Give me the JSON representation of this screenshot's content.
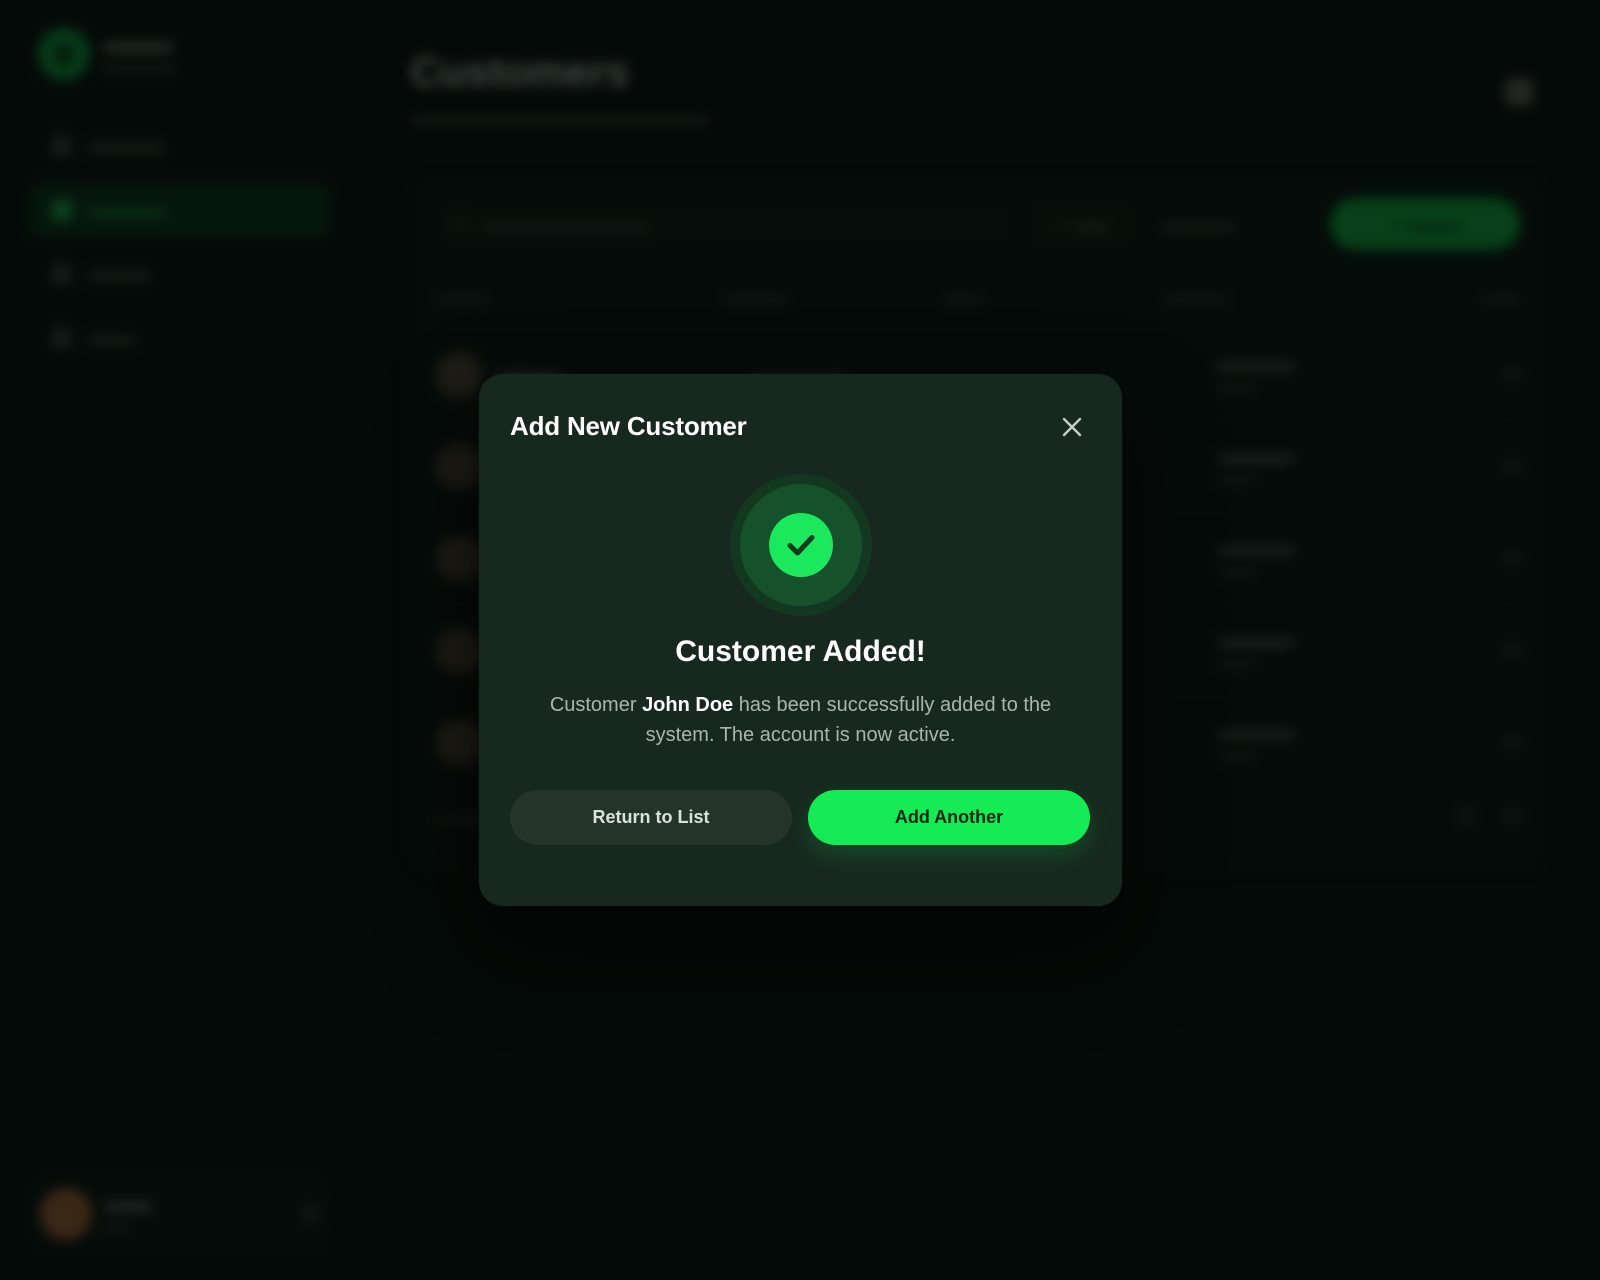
{
  "colors": {
    "accent": "#15eb55",
    "modal_bg": "#17281e",
    "page_bg": "#070d0a",
    "secondary_button_bg": "#243429"
  },
  "background": {
    "page_title": "Customers"
  },
  "modal": {
    "title": "Add New Customer",
    "close_icon": "close-icon",
    "success_icon": "check-circle-icon",
    "heading": "Customer Added!",
    "message": {
      "prefix": "Customer ",
      "customer_name": "John Doe",
      "suffix": " has been successfully added to the system. The account is now active."
    },
    "buttons": {
      "secondary_label": "Return to List",
      "primary_label": "Add Another"
    }
  }
}
